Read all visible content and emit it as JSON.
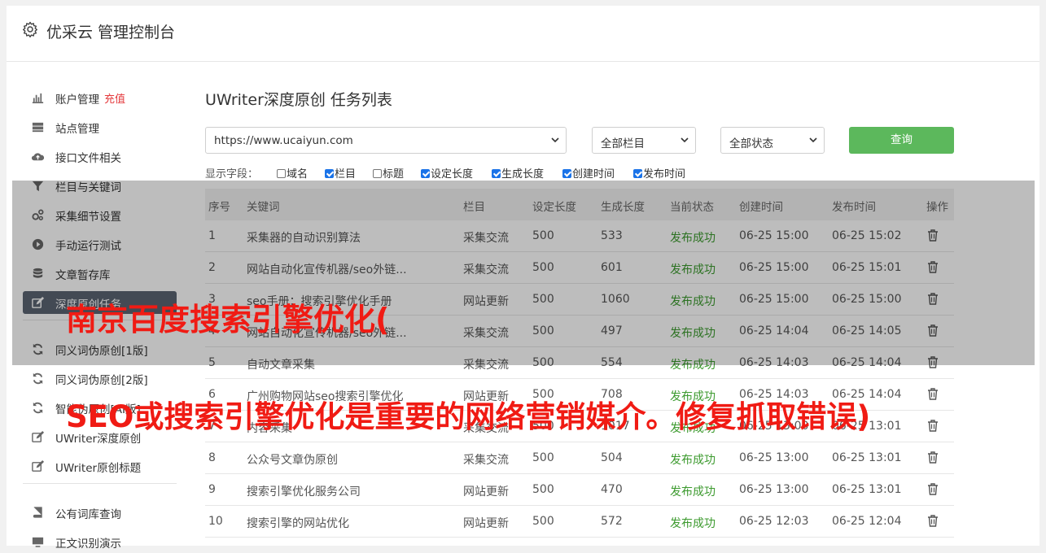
{
  "app": {
    "title": "优采云 管理控制台"
  },
  "sidebar": {
    "items": [
      {
        "label": "账户管理",
        "extra": "充值",
        "icon": "bar-chart-icon"
      },
      {
        "label": "站点管理",
        "icon": "server-icon"
      },
      {
        "label": "接口文件相关",
        "icon": "cloud-upload-icon"
      },
      {
        "label": "栏目与关键词",
        "icon": "filter-icon"
      },
      {
        "label": "采集细节设置",
        "icon": "gears-icon"
      },
      {
        "label": "手动运行测试",
        "icon": "play-circle-icon"
      },
      {
        "label": "文章暂存库",
        "icon": "database-icon"
      },
      {
        "label": "深度原创任务",
        "icon": "edit-icon"
      },
      {
        "label": "同义词伪原创[1版]",
        "icon": "refresh-icon"
      },
      {
        "label": "同义词伪原创[2版]",
        "icon": "refresh-icon"
      },
      {
        "label": "智能伪原创[AI版]",
        "icon": "refresh-icon"
      },
      {
        "label": "UWriter深度原创",
        "icon": "edit-icon"
      },
      {
        "label": "UWriter原创标题",
        "icon": "edit-icon"
      },
      {
        "label": "公有词库查询",
        "icon": "book-icon"
      },
      {
        "label": "正文识别演示",
        "icon": "monitor-icon"
      }
    ]
  },
  "main": {
    "title": "UWriter深度原创 任务列表",
    "site_select": "https://www.ucaiyun.com",
    "category_select": "全部栏目",
    "status_select": "全部状态",
    "query_button": "查询",
    "fields_label": "显示字段：",
    "fields": [
      {
        "label": "域名",
        "checked": false
      },
      {
        "label": "栏目",
        "checked": true
      },
      {
        "label": "标题",
        "checked": false
      },
      {
        "label": "设定长度",
        "checked": true
      },
      {
        "label": "生成长度",
        "checked": true
      },
      {
        "label": "创建时间",
        "checked": true
      },
      {
        "label": "发布时间",
        "checked": true
      }
    ]
  },
  "table": {
    "headers": [
      "序号",
      "关键词",
      "栏目",
      "设定长度",
      "生成长度",
      "当前状态",
      "创建时间",
      "发布时间",
      "操作"
    ],
    "rows": [
      [
        "1",
        "采集器的自动识别算法",
        "采集交流",
        "500",
        "533",
        "发布成功",
        "06-25 15:00",
        "06-25 15:02"
      ],
      [
        "2",
        "网站自动化宣传机器/seo外链...",
        "采集交流",
        "500",
        "601",
        "发布成功",
        "06-25 15:00",
        "06-25 15:01"
      ],
      [
        "3",
        "seo手册：搜索引擎优化手册",
        "网站更新",
        "500",
        "1060",
        "发布成功",
        "06-25 15:00",
        "06-25 15:00"
      ],
      [
        "4",
        "网站自动化宣传机器/seo外链...",
        "采集交流",
        "500",
        "497",
        "发布成功",
        "06-25 14:04",
        "06-25 14:05"
      ],
      [
        "5",
        "自动文章采集",
        "采集交流",
        "500",
        "554",
        "发布成功",
        "06-25 14:03",
        "06-25 14:04"
      ],
      [
        "6",
        "广州购物网站seo搜索引擎优化",
        "网站更新",
        "500",
        "708",
        "发布成功",
        "06-25 14:03",
        "06-25 14:04"
      ],
      [
        "7",
        "内容采集",
        "采集交流",
        "500",
        "1017",
        "发布成功",
        "06-25 13:00",
        "06-25 13:01"
      ],
      [
        "8",
        "公众号文章伪原创",
        "采集交流",
        "500",
        "504",
        "发布成功",
        "06-25 13:00",
        "06-25 13:01"
      ],
      [
        "9",
        "搜索引擎优化服务公司",
        "网站更新",
        "500",
        "470",
        "发布成功",
        "06-25 13:00",
        "06-25 13:01"
      ],
      [
        "10",
        "搜索引擎的网站优化",
        "网站更新",
        "500",
        "572",
        "发布成功",
        "06-25 12:03",
        "06-25 12:04"
      ]
    ]
  },
  "watermark": {
    "line1": "南京百度搜索引擎优化(",
    "line2": "SEO或搜索引擎优化是重要的网络营销媒介。修复抓取错误)"
  }
}
